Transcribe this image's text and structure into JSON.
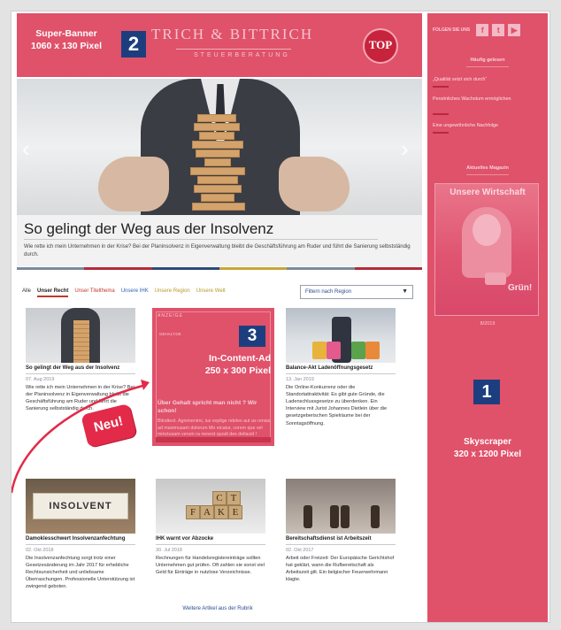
{
  "banner": {
    "logo_text": "TRICH & BITTRICH",
    "logo_subtitle": "STEUERBERATUNG",
    "top_badge": "TOP",
    "ad_name": "Super-Banner",
    "ad_size": "1060 x 130 Pixel",
    "number": "2"
  },
  "hero": {
    "title": "So gelingt der Weg aus der Insolvenz",
    "description": "Wie rette ich mein Unternehmen in der Krise? Bei der Planinsolvenz in Eigenverwaltung bleibt die Geschäftsführung am Ruder und führt die Sanierung selbstständig durch.",
    "prev_arrow": "‹",
    "next_arrow": "›",
    "stripe_colors": [
      "#7a8a9c",
      "#b02c3a",
      "#2c4a7a",
      "#c6a637",
      "#7a8a9c",
      "#b02c3a"
    ]
  },
  "tabs": [
    {
      "label": "Alle",
      "style": "plain"
    },
    {
      "label": "Unser Recht",
      "style": "active"
    },
    {
      "label": "Unser Titelthema",
      "style": "red"
    },
    {
      "label": "Unsere IHK",
      "style": "blue"
    },
    {
      "label": "Unsere Region",
      "style": "olive"
    },
    {
      "label": "Unsere Welt",
      "style": "olive"
    }
  ],
  "filter": {
    "label": "Filtern nach Region",
    "caret": "▼"
  },
  "articles": {
    "a1": {
      "title": "So gelingt der Weg aus der Insolvenz",
      "date": "07. Aug 2019",
      "text": "Wie rette ich mein Unternehmen in der Krise? Bei der Planinsolvenz in Eigenverwaltung bleibt die Geschäftsführung am Ruder und führt die Sanierung selbstständig durch."
    },
    "a3": {
      "title": "Balance-Akt Ladenöffnungsgesetz",
      "date": "13. Jan 2019",
      "text": "Die Online-Konkurrenz oder die Standortattraktivität: Es gibt gute Gründe, die Ladenschlussgesetze zu überdenken. Ein Interview mit Jurist Johannes Dietlein über die gesetzgeberischen Spielräume bei der Sonntagsöffnung."
    },
    "a4": {
      "image_text": "INSOLVENT",
      "title": "Damoklesschwert Insolvenzanfechtung",
      "date": "02. Okt 2018",
      "text": "Die Insolvenzanfechtung sorgt trotz einer Gesetzesänderung im Jahr 2017 für erhebliche Rechtsunsicherheit und unliebsame Überraschungen. Professionelle Unterstützung ist zwingend geboten."
    },
    "a5": {
      "cubes": [
        "F",
        "A",
        "K",
        "E",
        "C",
        "T"
      ],
      "title": "IHK warnt vor Abzocke",
      "date": "30. Jul 2018",
      "text": "Rechnungen für Handelsregistereinträge sollten Unternehmen gut prüfen. Oft zahlen sie sonst viel Geld für Einträge in nutzlose Verzeichnisse."
    },
    "a6": {
      "title": "Bereitschaftsdienst ist Arbeitszeit",
      "date": "02. Okt 2017",
      "text": "Arbeit oder Freizeit: Der Europäische Gerichtshof hat geklärt, wann die Rufbereitschaft als Arbeitszeit gilt. Ein belgischer Feuerwehrmann klagte."
    }
  },
  "incontent_ad": {
    "tag": "ANZEIGE",
    "brand": "GEHALT.DE",
    "number": "3",
    "ad_name": "In-Content-Ad",
    "ad_size": "250 x 300 Pixel",
    "title": "Über Gehalt spricht man nicht ? Wir schon!",
    "text": "Blindtext. Agnimenimi, ius explige ndeles aut as renias ad maximusam dolorum Mo eicatur, corem que vel minctusam verum ra nonest quodi des dellacid !"
  },
  "neu_label": "Neu!",
  "more_link": "Weitere Artikel aus der Rubrik",
  "sidebar": {
    "follow_label": "FOLGEN SIE UNS",
    "social": [
      "f",
      "t",
      "▶"
    ],
    "popular_heading": "Häufig gelesen",
    "popular_links": [
      "„Qualität setzt sich durch“",
      "Persönliches Wachstum ermöglichen",
      "Eine ungewöhnliche Nachfolge"
    ],
    "magazine_heading": "Aktuelles Magazin",
    "magazine_title": "Unsere Wirtschaft",
    "magazine_cover_word": "Grün!",
    "magazine_date": "8/2019",
    "number": "1",
    "ad_name": "Skyscraper",
    "ad_size": "320 x 1200 Pixel"
  }
}
